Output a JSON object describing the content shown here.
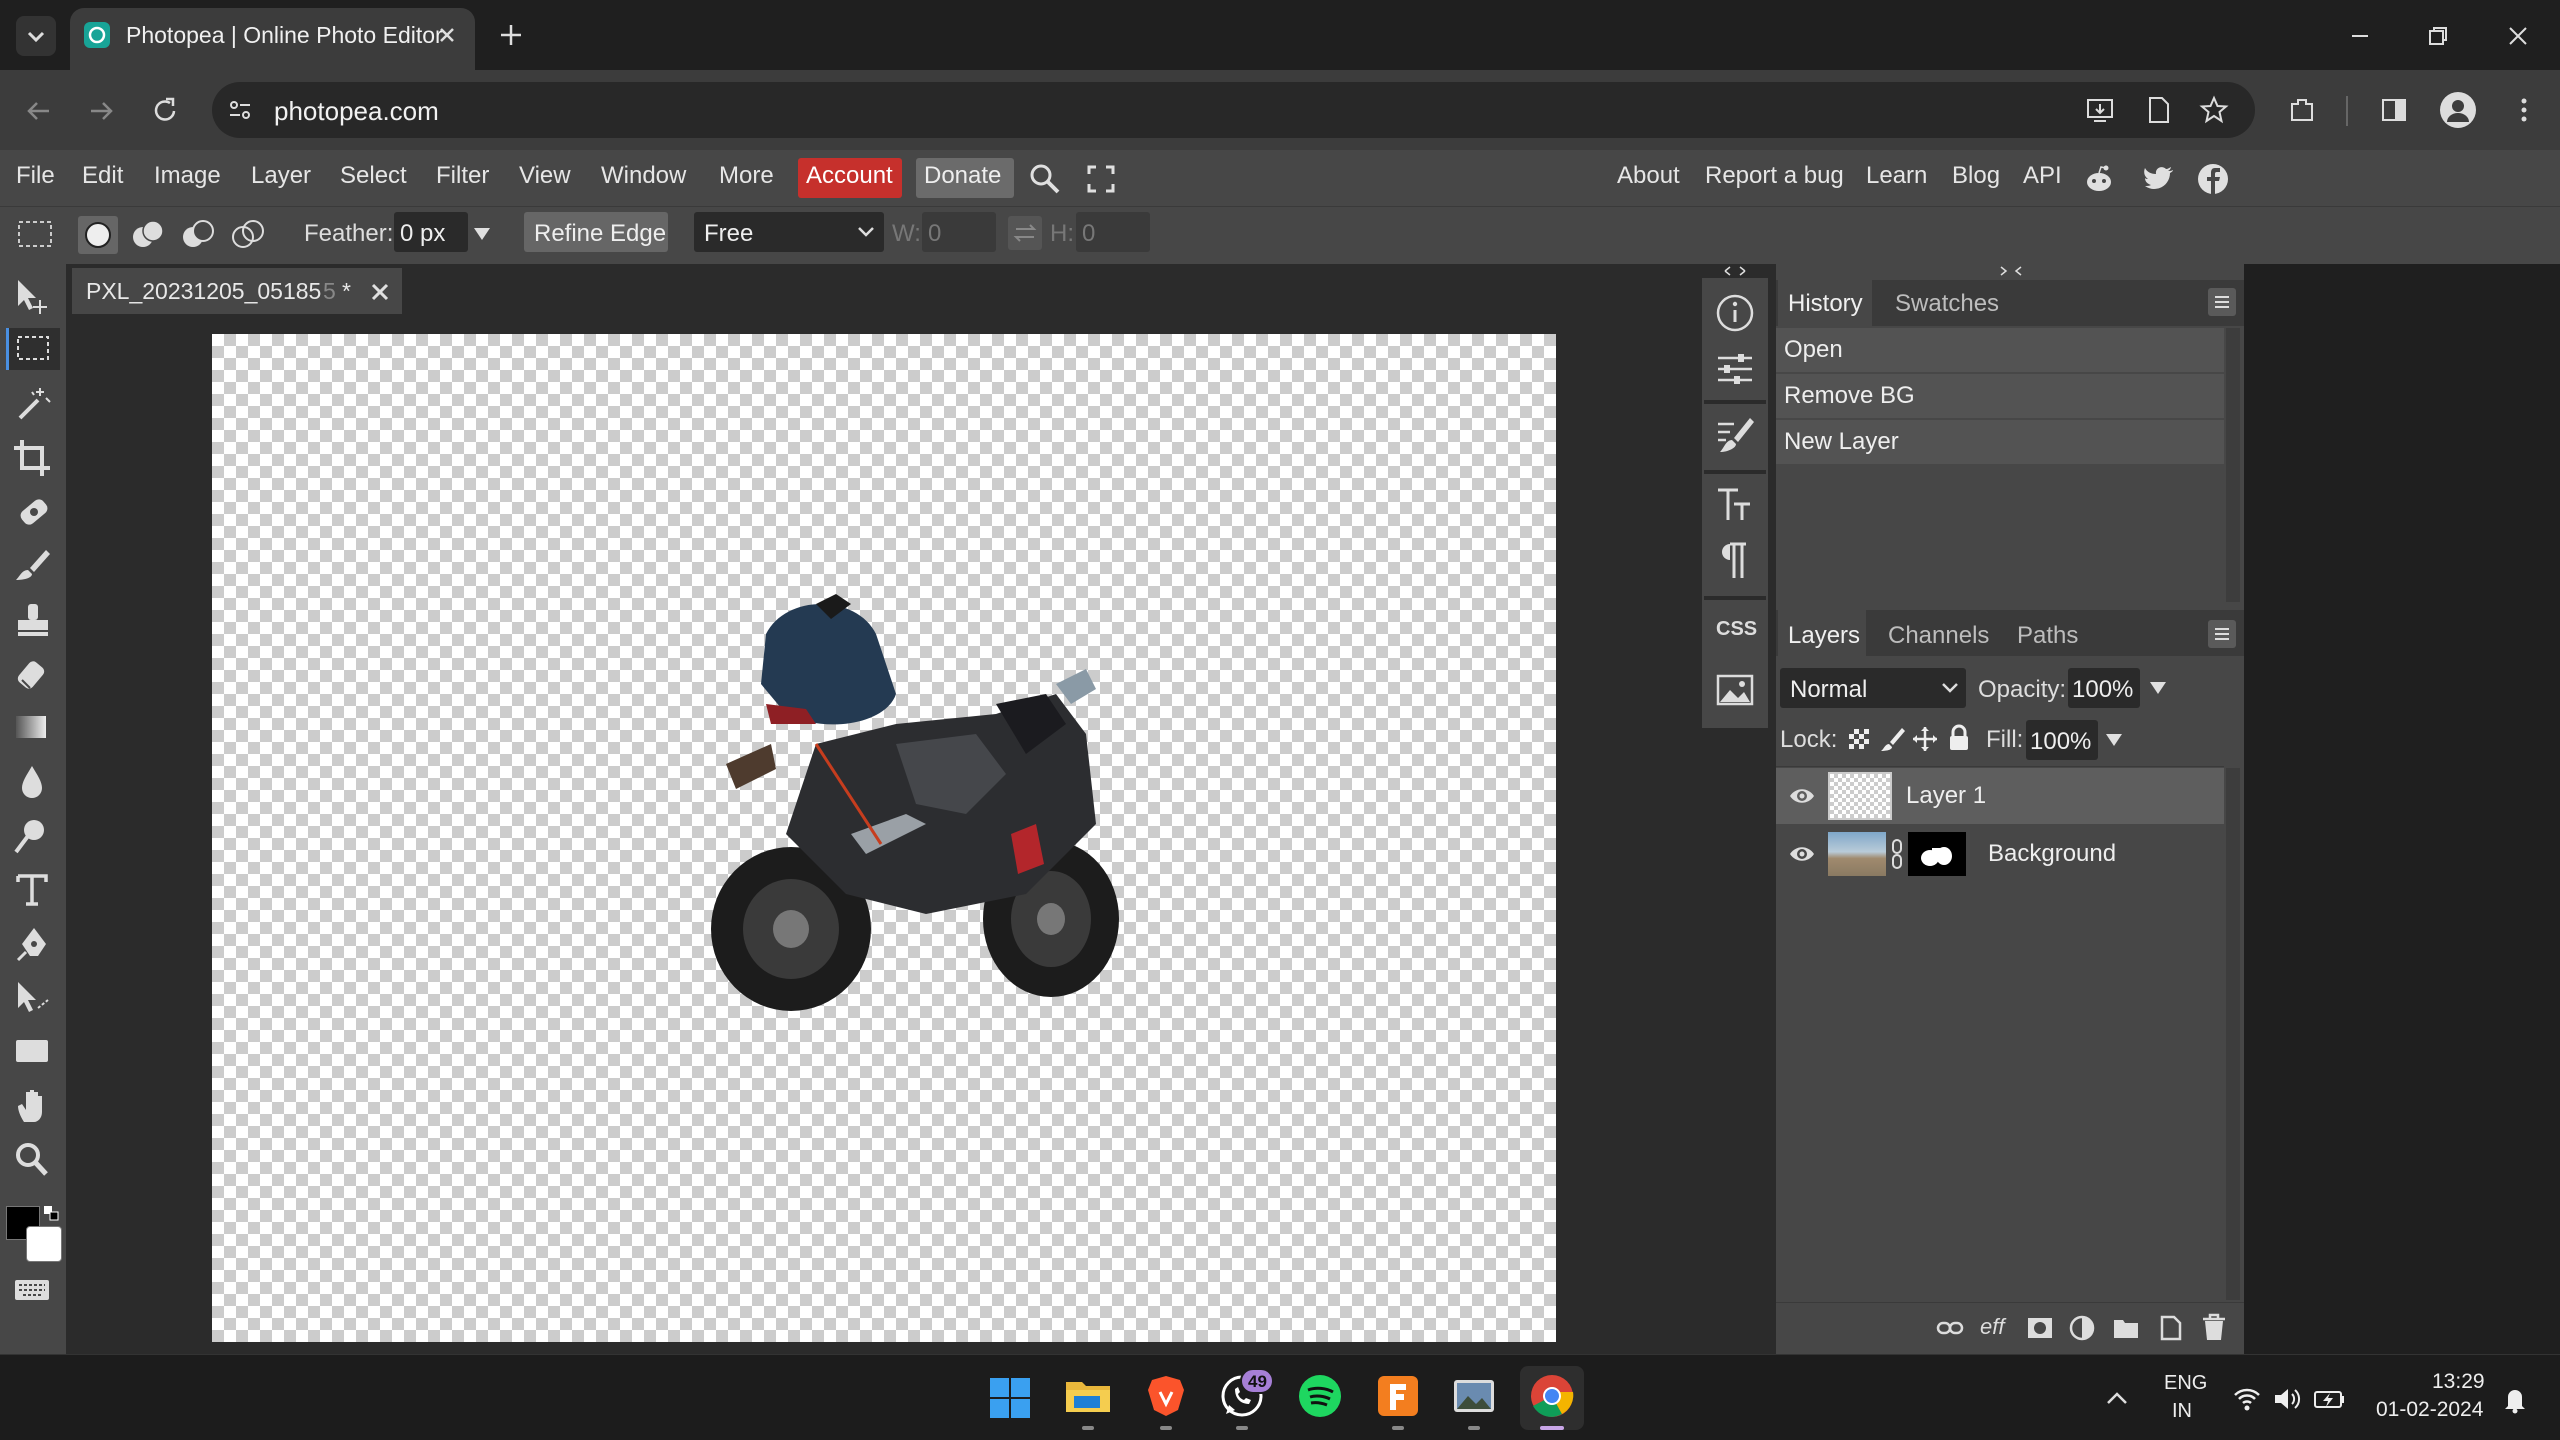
{
  "browser": {
    "tab_title": "Photopea | Online Photo Editor",
    "url": "photopea.com"
  },
  "menubar": {
    "items": [
      "File",
      "Edit",
      "Image",
      "Layer",
      "Select",
      "Filter",
      "View",
      "Window",
      "More"
    ],
    "account": "Account",
    "donate": "Donate",
    "right_links": [
      "About",
      "Report a bug",
      "Learn",
      "Blog",
      "API"
    ]
  },
  "options": {
    "feather_label": "Feather:",
    "feather_value": "0 px",
    "refine_edge": "Refine Edge",
    "style_value": "Free",
    "w_label": "W:",
    "w_value": "0",
    "h_label": "H:",
    "h_value": "0"
  },
  "document": {
    "tab_title": "PXL_20231205_05185",
    "tab_title_faded": "5",
    "modified_mark": "*"
  },
  "history_panel": {
    "tabs": [
      "History",
      "Swatches"
    ],
    "items": [
      "Open",
      "Remove BG",
      "New Layer"
    ]
  },
  "layers_panel": {
    "tabs": [
      "Layers",
      "Channels",
      "Paths"
    ],
    "blend_mode": "Normal",
    "opacity_label": "Opacity:",
    "opacity_value": "100%",
    "lock_label": "Lock:",
    "fill_label": "Fill:",
    "fill_value": "100%",
    "layers": [
      {
        "name": "Layer 1"
      },
      {
        "name": "Background"
      }
    ],
    "footer_eff": "eff"
  },
  "side_icons": {
    "css": "CSS"
  },
  "taskbar": {
    "whatsapp_badge": "49",
    "lang_top": "ENG",
    "lang_bottom": "IN",
    "time": "13:29",
    "date": "01-02-2024"
  },
  "colors": {
    "accent_red": "#c6302c",
    "panel": "#474747",
    "workspace": "#2b2b2b"
  }
}
